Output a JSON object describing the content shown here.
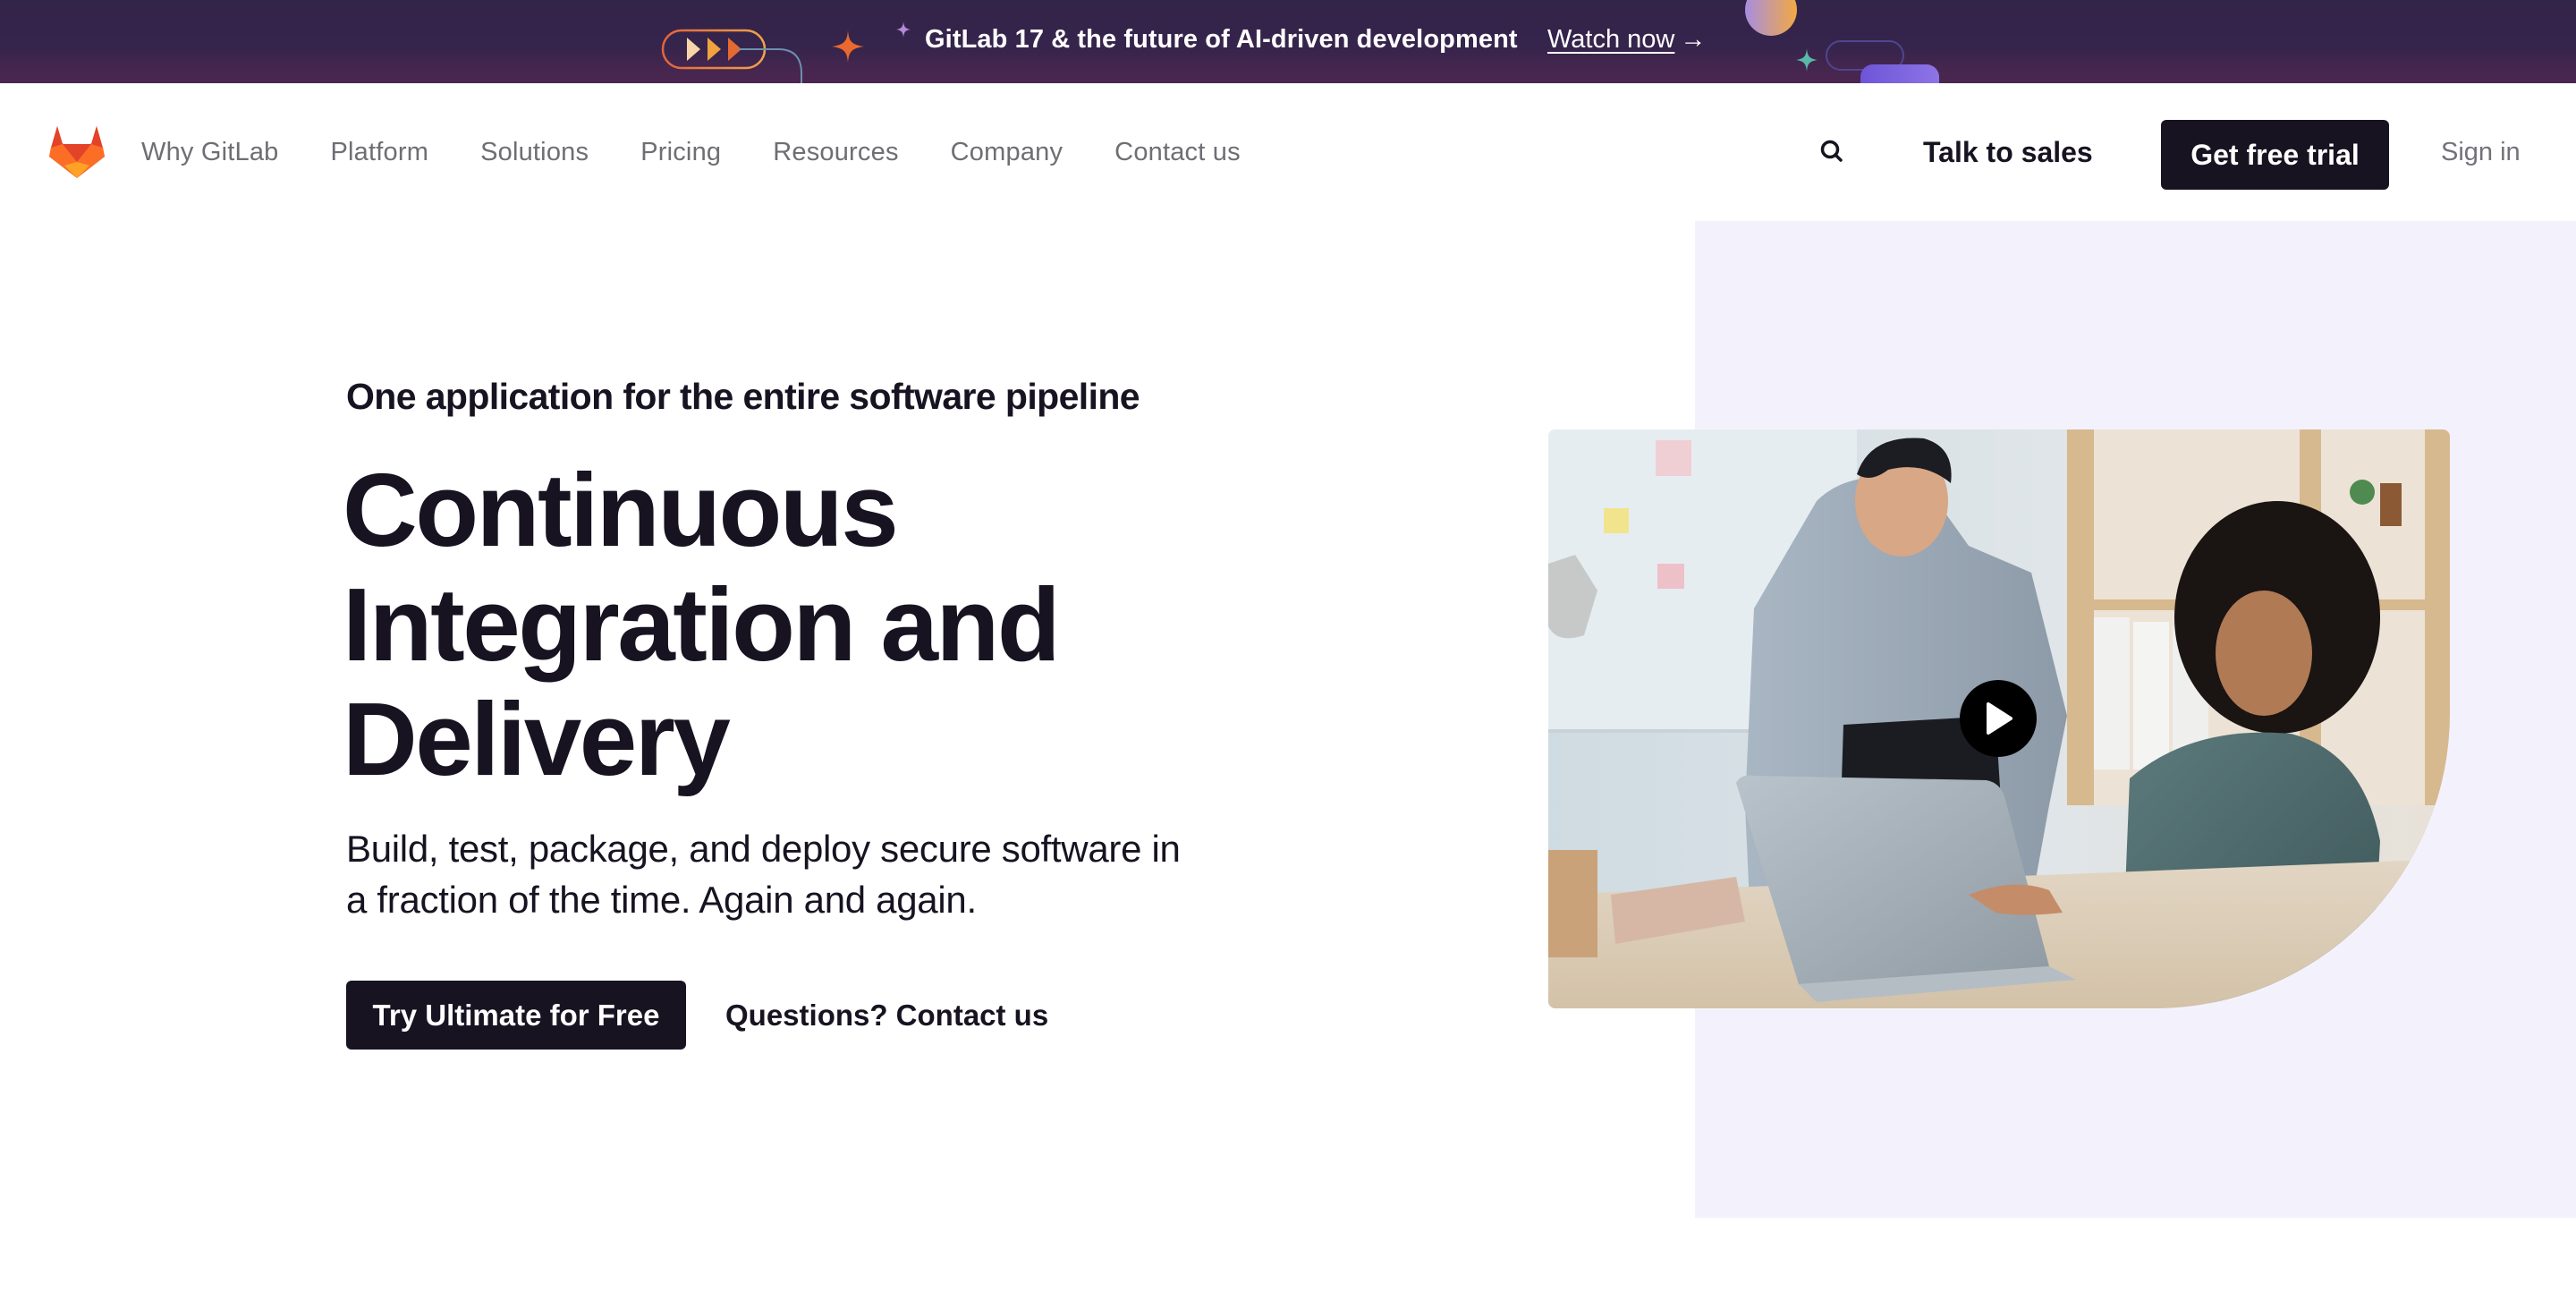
{
  "promo_banner": {
    "text": "GitLab 17 & the future of AI-driven development",
    "link_label": "Watch now",
    "link_arrow": "→",
    "background_color": "#33244a",
    "icons": [
      "fast-forward-pill-icon",
      "orange-sparkle-icon",
      "purple-sparkle-icon",
      "gradient-circle-icon",
      "teal-sparkle-icon",
      "outline-pill-icon",
      "purple-pill-icon"
    ]
  },
  "nav": {
    "logo": "gitlab-tanuki-logo",
    "links": [
      {
        "label": "Why GitLab"
      },
      {
        "label": "Platform"
      },
      {
        "label": "Solutions"
      },
      {
        "label": "Pricing"
      },
      {
        "label": "Resources"
      },
      {
        "label": "Company"
      },
      {
        "label": "Contact us"
      }
    ],
    "search_icon": "search-icon",
    "talk_to_sales": "Talk to sales",
    "get_free_trial": "Get free trial",
    "sign_in": "Sign in"
  },
  "hero": {
    "eyebrow": "One application for the entire software pipeline",
    "headline_lines": [
      "Continuous",
      "Integration and",
      "Delivery"
    ],
    "subtext_lines": [
      "Build, test, package, and deploy secure software in",
      "a fraction of the time. Again and again."
    ],
    "primary_cta": "Try Ultimate for Free",
    "secondary_cta": "Questions? Contact us",
    "video": {
      "description": "Two colleagues smiling at a laptop in an office",
      "play_icon": "play-icon"
    },
    "panel_color": "#f3f2fc"
  },
  "colors": {
    "text_primary": "#171321",
    "nav_link": "#6e6e73",
    "button_dark": "#171321",
    "brand_orange": "#e24329",
    "brand_orange_light": "#fc6d26",
    "brand_yellow": "#fca326"
  }
}
